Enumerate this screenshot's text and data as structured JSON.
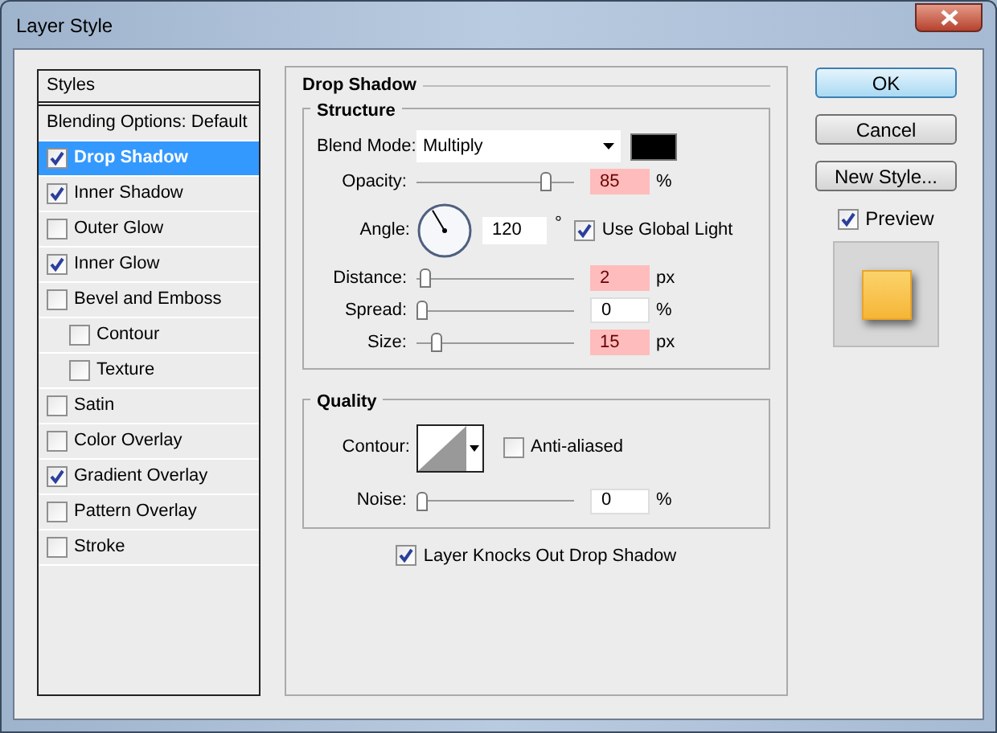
{
  "window": {
    "title": "Layer Style"
  },
  "styles_list": {
    "header": "Styles",
    "items": [
      {
        "kind": "option",
        "label": "Blending Options: Default",
        "selected": false
      },
      {
        "kind": "effect",
        "label": "Drop Shadow",
        "checked": true,
        "selected": true
      },
      {
        "kind": "effect",
        "label": "Inner Shadow",
        "checked": true,
        "selected": false
      },
      {
        "kind": "effect",
        "label": "Outer Glow",
        "checked": false,
        "selected": false
      },
      {
        "kind": "effect",
        "label": "Inner Glow",
        "checked": true,
        "selected": false
      },
      {
        "kind": "effect",
        "label": "Bevel and Emboss",
        "checked": false,
        "selected": false,
        "children": [
          {
            "kind": "effect",
            "label": "Contour",
            "checked": false,
            "selected": false
          },
          {
            "kind": "effect",
            "label": "Texture",
            "checked": false,
            "selected": false
          }
        ]
      },
      {
        "kind": "effect",
        "label": "Satin",
        "checked": false,
        "selected": false
      },
      {
        "kind": "effect",
        "label": "Color Overlay",
        "checked": false,
        "selected": false
      },
      {
        "kind": "effect",
        "label": "Gradient Overlay",
        "checked": true,
        "selected": false
      },
      {
        "kind": "effect",
        "label": "Pattern Overlay",
        "checked": false,
        "selected": false
      },
      {
        "kind": "effect",
        "label": "Stroke",
        "checked": false,
        "selected": false
      }
    ]
  },
  "panel": {
    "title": "Drop Shadow",
    "structure": {
      "title": "Structure",
      "rows": [
        {
          "kind": "select",
          "label": "Blend Mode:",
          "value": "Multiply"
        },
        {
          "kind": "slider",
          "label": "Opacity:",
          "level": 0.85,
          "value": "85",
          "unit": "%",
          "highlighted": true
        },
        {
          "kind": "angle",
          "label": "Angle:",
          "value": "120",
          "unit": "°",
          "global_light": {
            "label": "Use Global Light",
            "checked": true
          }
        },
        {
          "kind": "slider",
          "label": "Distance:",
          "level": 0.02,
          "value": "2",
          "unit": "px",
          "highlighted": true
        },
        {
          "kind": "slider",
          "label": "Spread:",
          "level": 0,
          "value": "0",
          "unit": "%",
          "highlighted": false
        },
        {
          "kind": "slider",
          "label": "Size:",
          "level": 0.1,
          "value": "15",
          "unit": "px",
          "highlighted": true
        }
      ]
    },
    "quality": {
      "title": "Quality",
      "contour": {
        "label": "Contour:"
      },
      "anti_aliased": {
        "label": "Anti-aliased",
        "checked": false
      },
      "noise": {
        "label": "Noise:",
        "level": 0,
        "value": "0",
        "unit": "%",
        "highlighted": false
      }
    },
    "knockout": {
      "label": "Layer Knocks Out Drop Shadow",
      "checked": true
    }
  },
  "buttons": [
    {
      "label": "OK",
      "default": true
    },
    {
      "label": "Cancel",
      "default": false
    },
    {
      "label": "New Style...",
      "default": false
    }
  ],
  "preview": {
    "label": "Preview",
    "checked": true
  }
}
